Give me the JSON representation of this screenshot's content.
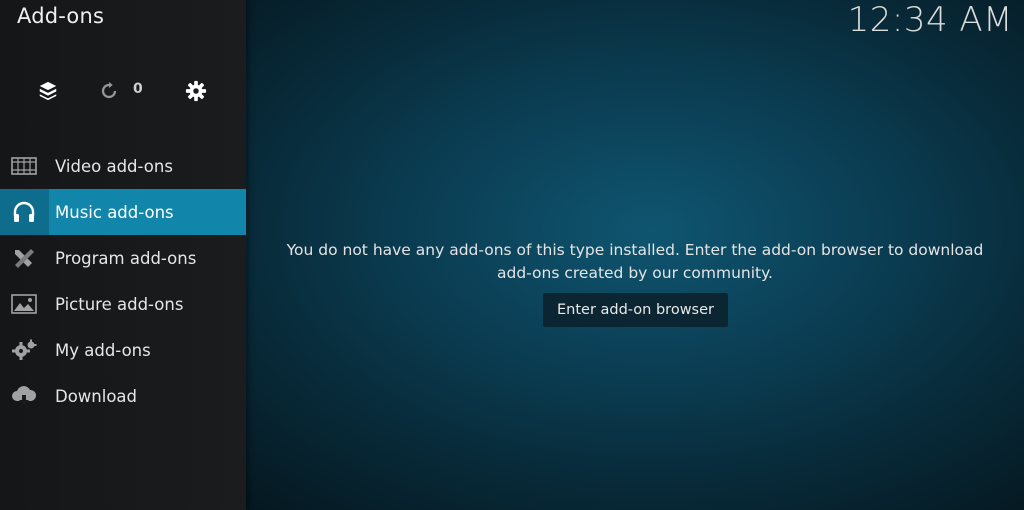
{
  "header": {
    "title": "Add-ons",
    "clock": "12:34 AM"
  },
  "toolbar": {
    "icons": [
      "box-icon",
      "refresh-icon",
      "gear-icon"
    ],
    "update_count": "0"
  },
  "sidebar": {
    "active_index": 1,
    "items": [
      {
        "label": "Video add-ons",
        "icon": "film-icon"
      },
      {
        "label": "Music add-ons",
        "icon": "headphones-icon"
      },
      {
        "label": "Program add-ons",
        "icon": "tools-icon"
      },
      {
        "label": "Picture add-ons",
        "icon": "picture-icon"
      },
      {
        "label": "My add-ons",
        "icon": "cogs-icon"
      },
      {
        "label": "Download",
        "icon": "cloud-download-icon"
      }
    ]
  },
  "main": {
    "message_line1": "You do not have any add-ons of this type installed. Enter the add-on browser to download",
    "message_line2": "add-ons created by our community.",
    "button_label": "Enter add-on browser"
  },
  "colors": {
    "active_item": "#1285ab",
    "active_icon_cell": "#0e6d8d",
    "sidebar_bg": "#1a1c1e",
    "button_bg": "#0b2632"
  }
}
